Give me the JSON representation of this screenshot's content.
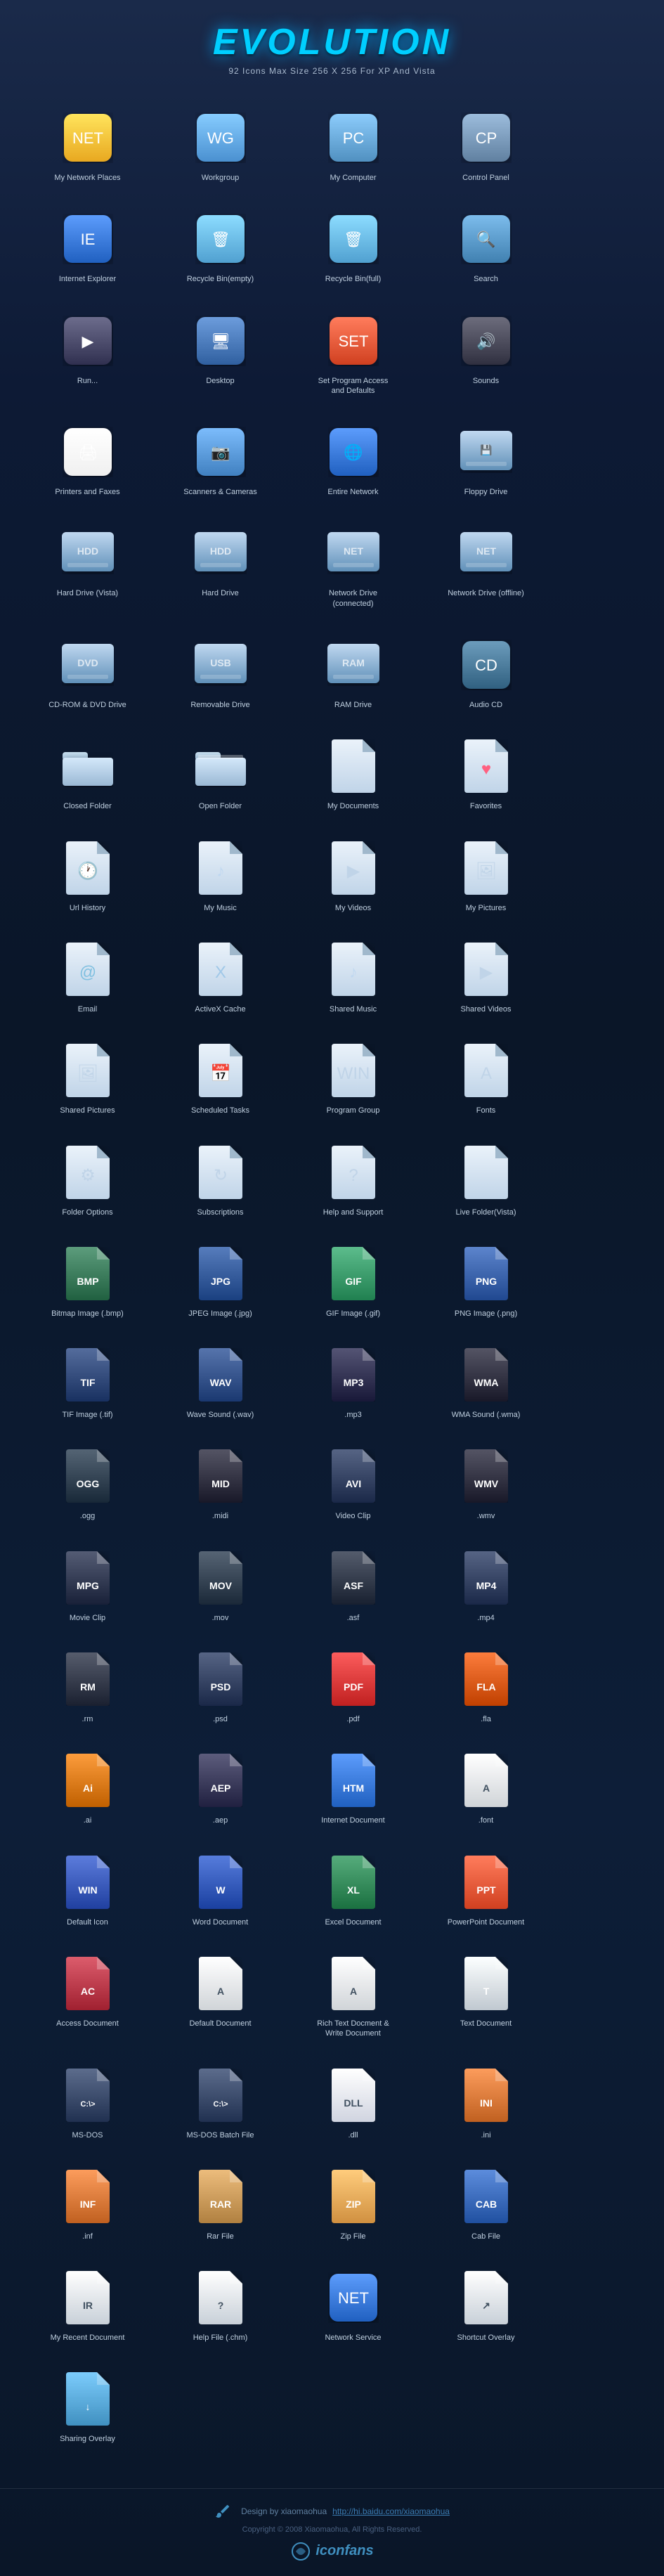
{
  "header": {
    "title": "EVOLUTION",
    "subtitle": "92 Icons Max Size 256 X 256  For  XP And Vista"
  },
  "icons": [
    {
      "id": "my-network-places",
      "label": "My Network Places",
      "color": "#e8a820",
      "type": "special",
      "text": "NET"
    },
    {
      "id": "workgroup",
      "label": "Workgroup",
      "color": "#4a90d0",
      "type": "special",
      "text": "WG"
    },
    {
      "id": "my-computer",
      "label": "My Computer",
      "color": "#5090c0",
      "type": "special",
      "text": "PC"
    },
    {
      "id": "control-panel",
      "label": "Control Panel",
      "color": "#6080a0",
      "type": "special",
      "text": "CP"
    },
    {
      "id": "internet-explorer",
      "label": "Internet Explorer",
      "color": "#2060c0",
      "type": "special",
      "text": "IE"
    },
    {
      "id": "recycle-bin-empty",
      "label": "Recycle Bin(empty)",
      "color": "#50a0d0",
      "type": "special",
      "text": "🗑"
    },
    {
      "id": "recycle-bin-full",
      "label": "Recycle Bin(full)",
      "color": "#50a0d0",
      "type": "special",
      "text": "🗑"
    },
    {
      "id": "search",
      "label": "Search",
      "color": "#4080b0",
      "type": "special",
      "text": "🔍"
    },
    {
      "id": "run",
      "label": "Run...",
      "color": "#303050",
      "type": "special",
      "text": "▶"
    },
    {
      "id": "desktop",
      "label": "Desktop",
      "color": "#3060a0",
      "type": "special",
      "text": "🖥"
    },
    {
      "id": "set-program-access",
      "label": "Set Program Access and Defaults",
      "color": "#d04020",
      "type": "special",
      "text": "SET"
    },
    {
      "id": "sounds",
      "label": "Sounds",
      "color": "#303040",
      "type": "special",
      "text": "🔊"
    },
    {
      "id": "printers-faxes",
      "label": "Printers and Faxes",
      "color": "#f0f0f0",
      "type": "special",
      "text": "🖨"
    },
    {
      "id": "scanners-cameras",
      "label": "Scanners & Cameras",
      "color": "#4080c0",
      "type": "special",
      "text": "📷"
    },
    {
      "id": "entire-network",
      "label": "Entire Network",
      "color": "#2060c0",
      "type": "special",
      "text": "🌐"
    },
    {
      "id": "floppy-drive",
      "label": "Floppy Drive",
      "color": "#8090a8",
      "type": "drive",
      "text": "💾"
    },
    {
      "id": "hard-drive-vista",
      "label": "Hard Drive (Vista)",
      "color": "#4070a0",
      "type": "drive",
      "text": "HDD"
    },
    {
      "id": "hard-drive",
      "label": "Hard Drive",
      "color": "#4070a0",
      "type": "drive",
      "text": "HDD"
    },
    {
      "id": "network-drive-connected",
      "label": "Network Drive (connected)",
      "color": "#406090",
      "type": "drive",
      "text": "NET"
    },
    {
      "id": "network-drive-offline",
      "label": "Network Drive (offline)",
      "color": "#304060",
      "type": "drive",
      "text": "NET"
    },
    {
      "id": "cdrom-dvd-drive",
      "label": "CD-ROM & DVD Drive",
      "color": "#8090a8",
      "type": "drive",
      "text": "DVD"
    },
    {
      "id": "removable-drive",
      "label": "Removable Drive",
      "color": "#7080a0",
      "type": "drive",
      "text": "USB"
    },
    {
      "id": "ram-drive",
      "label": "RAM Drive",
      "color": "#404050",
      "type": "drive",
      "text": "RAM"
    },
    {
      "id": "audio-cd",
      "label": "Audio CD",
      "color": "#306080",
      "type": "special",
      "text": "CD"
    },
    {
      "id": "closed-folder",
      "label": "Closed Folder",
      "color": "#b0c4d8",
      "type": "folder"
    },
    {
      "id": "open-folder",
      "label": "Open Folder",
      "color": "#b0c4d8",
      "type": "folder"
    },
    {
      "id": "my-documents",
      "label": "My Documents",
      "color": "#c8d8e8",
      "type": "document",
      "text": ""
    },
    {
      "id": "favorites",
      "label": "Favorites",
      "color": "#e8d0d8",
      "type": "document",
      "text": "♥"
    },
    {
      "id": "url-history",
      "label": "Url History",
      "color": "#c8d8e8",
      "type": "document",
      "text": "🕐"
    },
    {
      "id": "my-music",
      "label": "My Music",
      "color": "#c8d8e8",
      "type": "document",
      "text": "♪"
    },
    {
      "id": "my-videos",
      "label": "My Videos",
      "color": "#c8d8e8",
      "type": "document",
      "text": "▶"
    },
    {
      "id": "my-pictures",
      "label": "My Pictures",
      "color": "#c8d8e8",
      "type": "document",
      "text": "🖼"
    },
    {
      "id": "email",
      "label": "Email",
      "color": "#c8d8e8",
      "type": "document",
      "text": "@"
    },
    {
      "id": "activex-cache",
      "label": "ActiveX Cache",
      "color": "#c8d8e8",
      "type": "document",
      "text": "X"
    },
    {
      "id": "shared-music",
      "label": "Shared Music",
      "color": "#c8d8e8",
      "type": "document",
      "text": "♪"
    },
    {
      "id": "shared-videos",
      "label": "Shared Videos",
      "color": "#c8d8e8",
      "type": "document",
      "text": "▶"
    },
    {
      "id": "shared-pictures",
      "label": "Shared Pictures",
      "color": "#c8d8e8",
      "type": "document",
      "text": "🖼"
    },
    {
      "id": "scheduled-tasks",
      "label": "Scheduled Tasks",
      "color": "#c8d8e8",
      "type": "document",
      "text": "📅"
    },
    {
      "id": "program-group",
      "label": "Program Group",
      "color": "#c8d8e8",
      "type": "document",
      "text": "WIN"
    },
    {
      "id": "fonts",
      "label": "Fonts",
      "color": "#c8d0d8",
      "type": "document",
      "text": "A"
    },
    {
      "id": "folder-options",
      "label": "Folder Options",
      "color": "#c0c8d0",
      "type": "document",
      "text": "⚙"
    },
    {
      "id": "subscriptions",
      "label": "Subscriptions",
      "color": "#a0c8b0",
      "type": "document",
      "text": "↻"
    },
    {
      "id": "help-support",
      "label": "Help and Support",
      "color": "#c8d8e8",
      "type": "document",
      "text": "?"
    },
    {
      "id": "live-folder-vista",
      "label": "Live Folder(Vista)",
      "color": "#d0d8e0",
      "type": "document",
      "text": ""
    },
    {
      "id": "bitmap-image",
      "label": "Bitmap Image (.bmp)",
      "color": "#1a6030",
      "type": "filetype",
      "text": "BMP"
    },
    {
      "id": "jpeg-image",
      "label": "JPEG Image (.jpg)",
      "color": "#1a4080",
      "type": "filetype",
      "text": "JPG"
    },
    {
      "id": "gif-image",
      "label": "GIF Image (.gif)",
      "color": "#208040",
      "type": "filetype",
      "text": "GIF"
    },
    {
      "id": "png-image",
      "label": "PNG Image (.png)",
      "color": "#204080",
      "type": "filetype",
      "text": "PNG"
    },
    {
      "id": "tif-image",
      "label": "TIF Image (.tif)",
      "color": "#183060",
      "type": "filetype",
      "text": "TIF"
    },
    {
      "id": "wave-sound",
      "label": "Wave Sound (.wav)",
      "color": "#1a3870",
      "type": "filetype",
      "text": "WAV"
    },
    {
      "id": "mp3",
      "label": ".mp3",
      "color": "#181838",
      "type": "filetype",
      "text": "MP3"
    },
    {
      "id": "wma-sound",
      "label": "WMA Sound (.wma)",
      "color": "#181828",
      "type": "filetype",
      "text": "WMA"
    },
    {
      "id": "ogg",
      "label": ".ogg",
      "color": "#182838",
      "type": "filetype",
      "text": "OGG"
    },
    {
      "id": "midi",
      "label": ".midi",
      "color": "#181828",
      "type": "filetype",
      "text": "MID"
    },
    {
      "id": "video-clip",
      "label": "Video Clip",
      "color": "#1a2848",
      "type": "filetype",
      "text": "AVI"
    },
    {
      "id": "wmv",
      "label": ".wmv",
      "color": "#181828",
      "type": "filetype",
      "text": "WMV"
    },
    {
      "id": "movie-clip",
      "label": "Movie Clip",
      "color": "#182038",
      "type": "filetype",
      "text": "MPG"
    },
    {
      "id": "mov",
      "label": ".mov",
      "color": "#1a2838",
      "type": "filetype",
      "text": "MOV"
    },
    {
      "id": "asf",
      "label": ".asf",
      "color": "#182030",
      "type": "filetype",
      "text": "ASF"
    },
    {
      "id": "mp4",
      "label": ".mp4",
      "color": "#1a2848",
      "type": "filetype",
      "text": "MP4"
    },
    {
      "id": "rm",
      "label": ".rm",
      "color": "#1a2030",
      "type": "filetype",
      "text": "RM"
    },
    {
      "id": "psd",
      "label": ".psd",
      "color": "#1a2848",
      "type": "filetype",
      "text": "PSD"
    },
    {
      "id": "pdf",
      "label": ".pdf",
      "color": "#c02020",
      "type": "filetype",
      "text": "PDF"
    },
    {
      "id": "fla",
      "label": ".fla",
      "color": "#c04000",
      "type": "filetype",
      "text": "FLA"
    },
    {
      "id": "ai",
      "label": ".ai",
      "color": "#c06000",
      "type": "filetype",
      "text": "Ai"
    },
    {
      "id": "aep",
      "label": ".aep",
      "color": "#202040",
      "type": "filetype",
      "text": "AEP"
    },
    {
      "id": "internet-document",
      "label": "Internet Document",
      "color": "#2060c0",
      "type": "filetype",
      "text": "HTM"
    },
    {
      "id": "font",
      "label": ".font",
      "color": "#d0d4d8",
      "type": "filetype",
      "text": "A"
    },
    {
      "id": "default-icon",
      "label": "Default Icon",
      "color": "#2040a0",
      "type": "filetype",
      "text": "WIN"
    },
    {
      "id": "word-document",
      "label": "Word Document",
      "color": "#1a40a0",
      "type": "filetype",
      "text": "W"
    },
    {
      "id": "excel-document",
      "label": "Excel Document",
      "color": "#1a7040",
      "type": "filetype",
      "text": "XL"
    },
    {
      "id": "powerpoint-document",
      "label": "PowerPoint Document",
      "color": "#d04020",
      "type": "filetype",
      "text": "PPT"
    },
    {
      "id": "access-document",
      "label": "Access Document",
      "color": "#a02030",
      "type": "filetype",
      "text": "AC"
    },
    {
      "id": "default-document",
      "label": "Default Document",
      "color": "#d0d4d8",
      "type": "filetype",
      "text": "A"
    },
    {
      "id": "rich-text-document",
      "label": "Rich Text Docment & Write Document",
      "color": "#c8d0d8",
      "type": "filetype",
      "text": "A"
    },
    {
      "id": "text-document",
      "label": "Text Document",
      "color": "#c0c8d0",
      "type": "filetype",
      "text": "T"
    },
    {
      "id": "ms-dos",
      "label": "MS-DOS",
      "color": "#203050",
      "type": "filetype",
      "text": "C:\\>"
    },
    {
      "id": "ms-dos-batch",
      "label": "MS-DOS Batch File",
      "color": "#203050",
      "type": "filetype",
      "text": "C:\\>"
    },
    {
      "id": "dll",
      "label": ".dll",
      "color": "#d0d4e0",
      "type": "filetype",
      "text": "DLL"
    },
    {
      "id": "ini",
      "label": ".ini",
      "color": "#c06020",
      "type": "filetype",
      "text": "INI"
    },
    {
      "id": "inf",
      "label": ".inf",
      "color": "#c06020",
      "type": "filetype",
      "text": "INF"
    },
    {
      "id": "rar-file",
      "label": "Rar File",
      "color": "#b08040",
      "type": "filetype",
      "text": "RAR"
    },
    {
      "id": "zip-file",
      "label": "Zip File",
      "color": "#d09040",
      "type": "filetype",
      "text": "ZIP"
    },
    {
      "id": "cab-file",
      "label": "Cab File",
      "color": "#2050a0",
      "type": "filetype",
      "text": "CAB"
    },
    {
      "id": "my-recent-document",
      "label": "My Recent Document",
      "color": "#c8d0d8",
      "type": "filetype",
      "text": "IR"
    },
    {
      "id": "help-file",
      "label": "Help File (.chm)",
      "color": "#c8d0d8",
      "type": "filetype",
      "text": "?"
    },
    {
      "id": "network-service",
      "label": "Network Service",
      "color": "#2060c0",
      "type": "special",
      "text": "NET"
    },
    {
      "id": "shortcut-overlay",
      "label": "Shortcut Overlay",
      "color": "#c8d0d8",
      "type": "filetype",
      "text": "↗"
    },
    {
      "id": "sharing-overlay",
      "label": "Sharing Overlay",
      "color": "#4090c0",
      "type": "filetype",
      "text": "↓"
    }
  ],
  "footer": {
    "design_label": "Design by xiaomaohua",
    "url": "http://hi.baidu.com/xiaomaohua",
    "copyright": "Copyright © 2008 Xiaomaohua, All Rights Reserved.",
    "logo": "iconfans"
  }
}
